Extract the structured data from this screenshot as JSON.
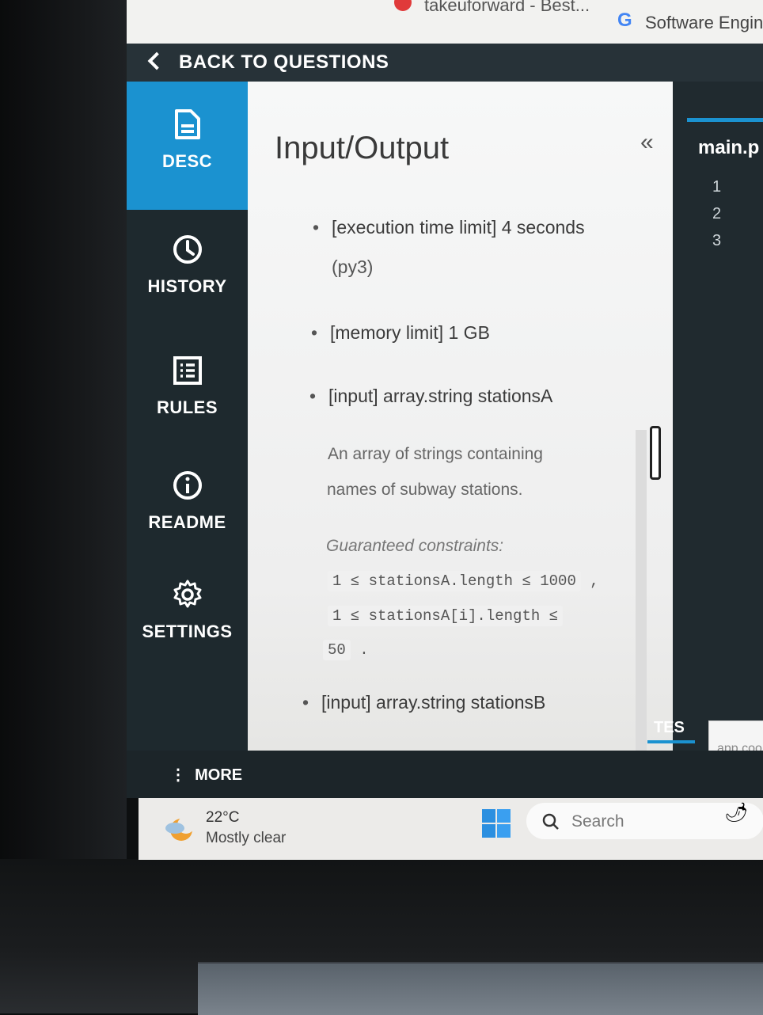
{
  "browser": {
    "tabs": [
      {
        "title": "takeuforward - Best..."
      },
      {
        "favicon": "G",
        "title": "Software Engine"
      }
    ]
  },
  "header": {
    "back_label": "BACK TO QUESTIONS"
  },
  "sidebar": {
    "items": [
      {
        "label": "DESC",
        "icon": "document-icon",
        "active": true
      },
      {
        "label": "HISTORY",
        "icon": "clock-icon",
        "active": false
      },
      {
        "label": "RULES",
        "icon": "list-icon",
        "active": false
      },
      {
        "label": "README",
        "icon": "info-icon",
        "active": false
      },
      {
        "label": "SETTINGS",
        "icon": "gear-icon",
        "active": false
      }
    ],
    "more_label": "MORE"
  },
  "description": {
    "collapse_symbol": "«",
    "title": "Input/Output",
    "time_limit_label": "[execution time limit] 4 seconds",
    "time_limit_suffix": "(py3)",
    "memory_limit": "[memory limit] 1 GB",
    "input_a": "[input] array.string stationsA",
    "input_a_desc_1": "An array of strings containing",
    "input_a_desc_2": "names of subway stations.",
    "constraints_label": "Guaranteed constraints:",
    "constraint_1": "1 ≤ stationsA.length ≤ 1000",
    "constraint_1_suffix": ",",
    "constraint_2": "1 ≤ stationsA[i].length ≤",
    "constraint_2_cont": "50",
    "constraint_2_suffix": ".",
    "input_b": "[input] array.string stationsB"
  },
  "editor": {
    "file_tab": "main.p",
    "line_numbers": [
      "1",
      "2",
      "3"
    ],
    "tests_tab": "TES",
    "popup_text": "app.coo"
  },
  "taskbar": {
    "temperature": "22°C",
    "weather": "Mostly clear",
    "search_placeholder": "Search"
  },
  "colors": {
    "accent": "#1b92d0",
    "sidebar_bg": "#1e292e",
    "header_bg": "#273238"
  }
}
